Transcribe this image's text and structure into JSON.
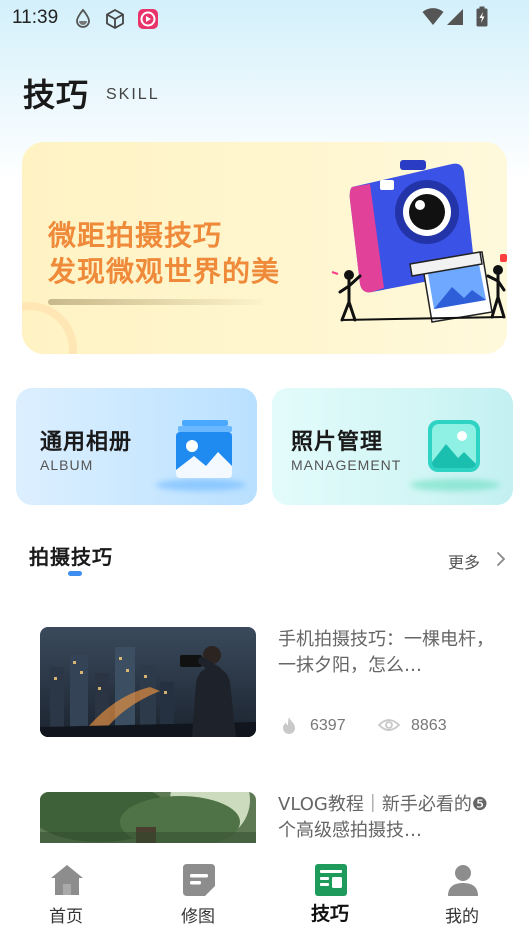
{
  "status_bar": {
    "time": "11:39"
  },
  "header": {
    "title": "技巧",
    "subtitle": "SKILL"
  },
  "banner": {
    "line1": "微距拍摄技巧",
    "line2": "发现微观世界的美"
  },
  "cards": [
    {
      "title": "通用相册",
      "subtitle": "ALBUM"
    },
    {
      "title": "照片管理",
      "subtitle": "MANAGEMENT"
    }
  ],
  "section": {
    "title": "拍摄技巧",
    "more": "更多"
  },
  "articles": [
    {
      "title": "手机拍摄技巧：一棵电杆，一抹夕阳，怎么…",
      "likes": "6397",
      "views": "8863"
    },
    {
      "title": "VLOG教程｜新手必看的❺个高级感拍摄技…"
    }
  ],
  "nav": [
    {
      "label": "首页",
      "icon": "home-icon",
      "active": false
    },
    {
      "label": "修图",
      "icon": "edit-photo-icon",
      "active": false
    },
    {
      "label": "技巧",
      "icon": "skill-icon",
      "active": true
    },
    {
      "label": "我的",
      "icon": "profile-icon",
      "active": false
    }
  ],
  "colors": {
    "accent": "#3d8ef0",
    "banner_text": "#ef8a3a",
    "active_nav": "#1e9a5b"
  }
}
